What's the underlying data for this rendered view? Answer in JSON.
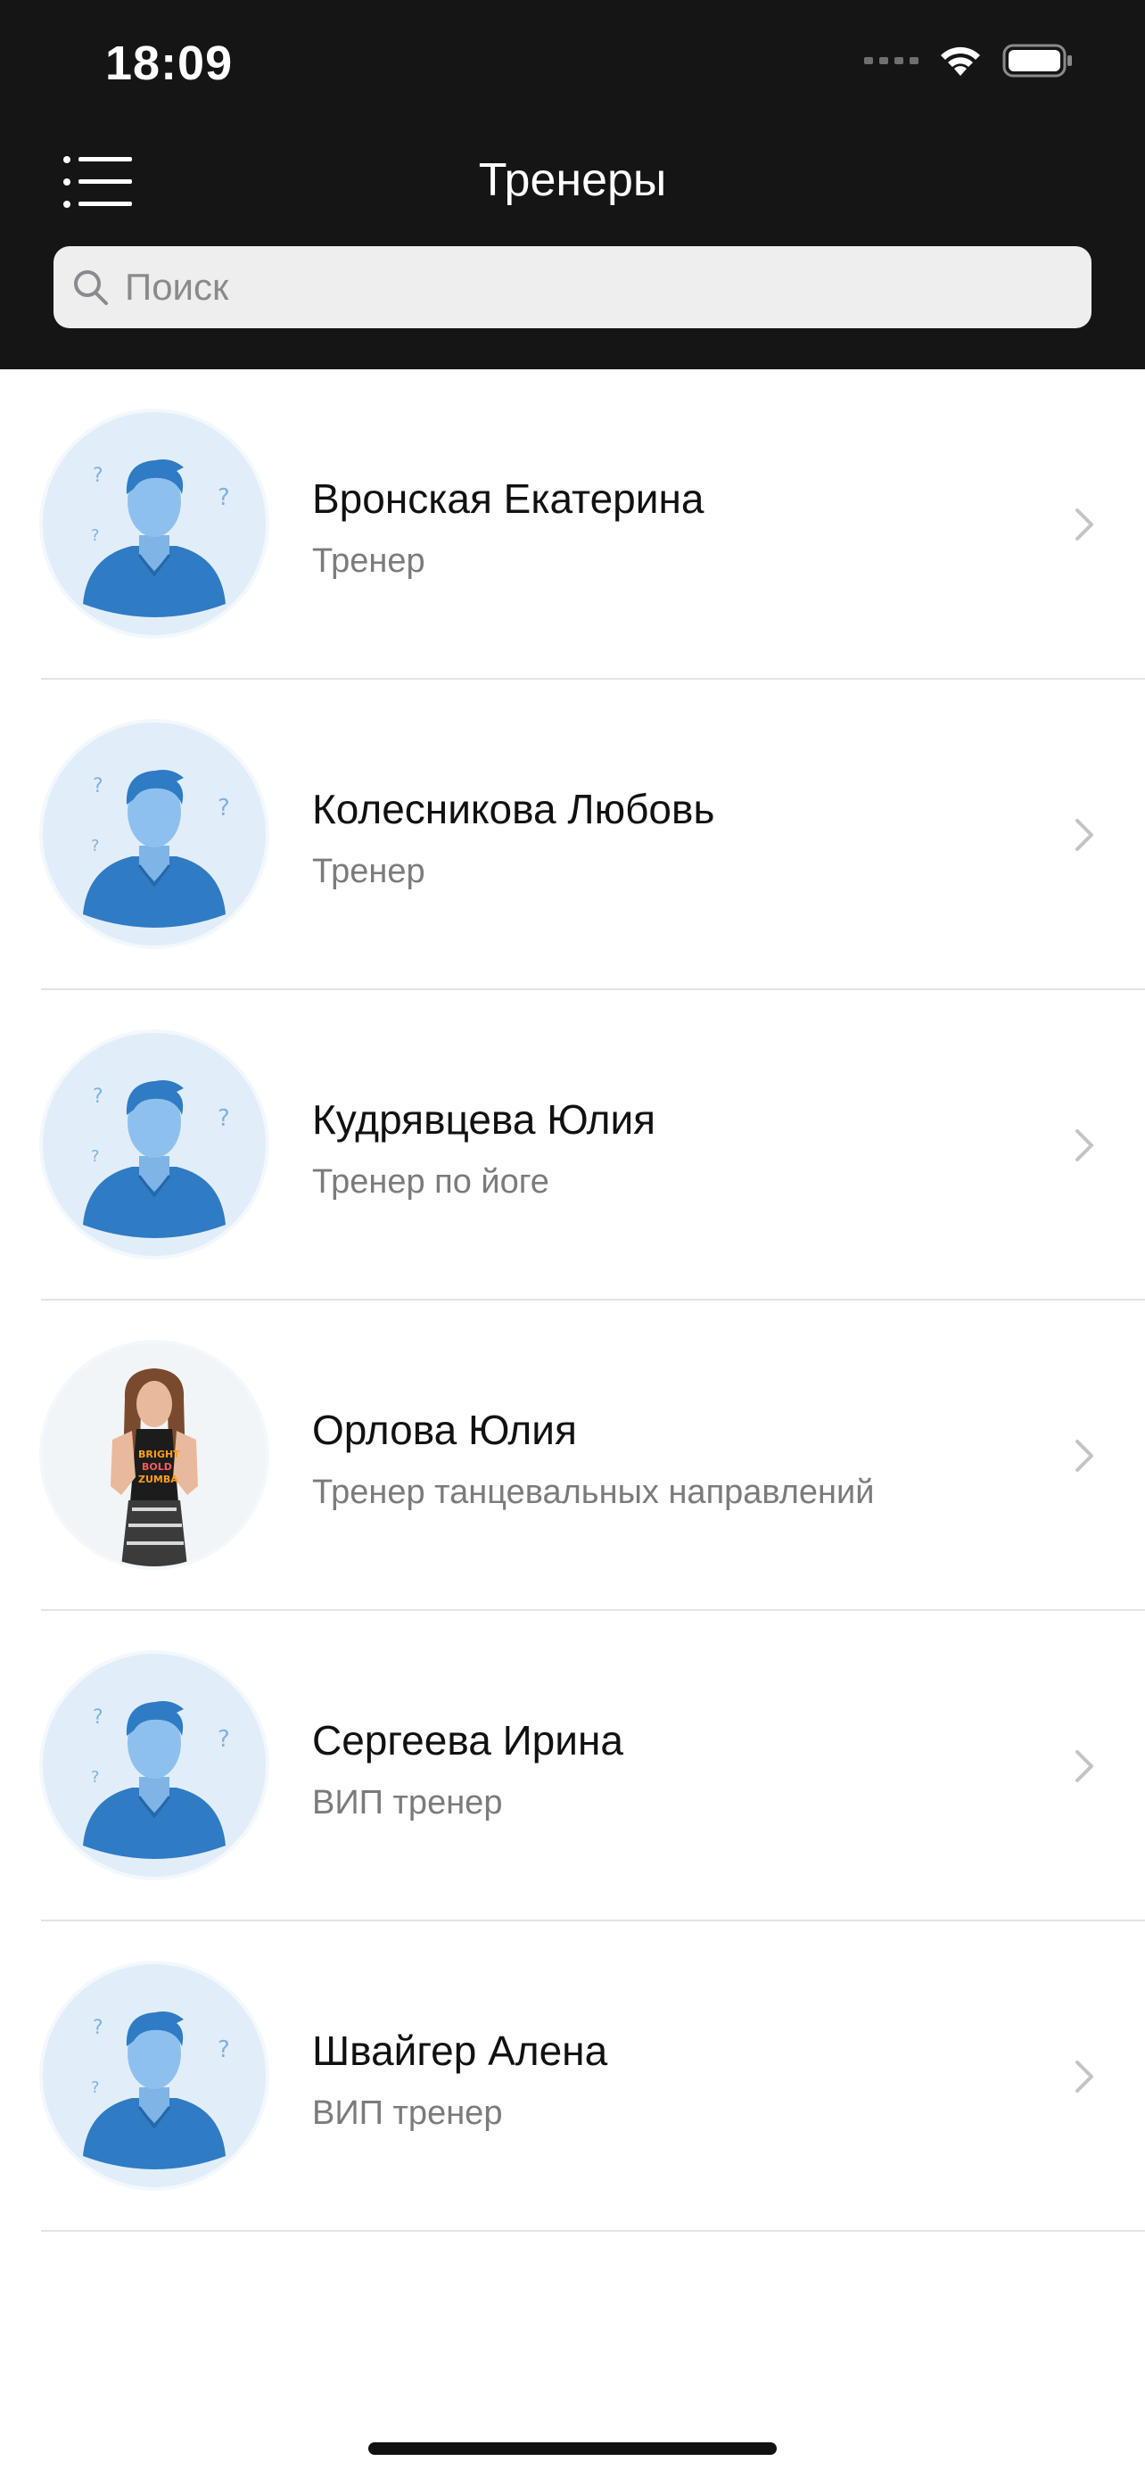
{
  "status_bar": {
    "time": "18:09"
  },
  "header": {
    "title": "Тренеры"
  },
  "search": {
    "placeholder": "Поиск"
  },
  "trainers": [
    {
      "name": "Вронская Екатерина",
      "role": "Тренер",
      "avatar": "placeholder-avatar"
    },
    {
      "name": "Колесникова Любовь",
      "role": "Тренер",
      "avatar": "placeholder-avatar"
    },
    {
      "name": "Кудрявцева Юлия",
      "role": "Тренер по йоге",
      "avatar": "placeholder-avatar"
    },
    {
      "name": "Орлова Юлия",
      "role": "Тренер танцевальных направлений",
      "avatar": "photo"
    },
    {
      "name": "Сергеева Ирина",
      "role": "ВИП тренер",
      "avatar": "placeholder-avatar"
    },
    {
      "name": "Швайгер Алена",
      "role": "ВИП тренер",
      "avatar": "placeholder-avatar"
    }
  ],
  "colors": {
    "header_bg": "#151515",
    "avatar_bg": "#e1eef9",
    "avatar_fg": "#2f7bc4"
  }
}
